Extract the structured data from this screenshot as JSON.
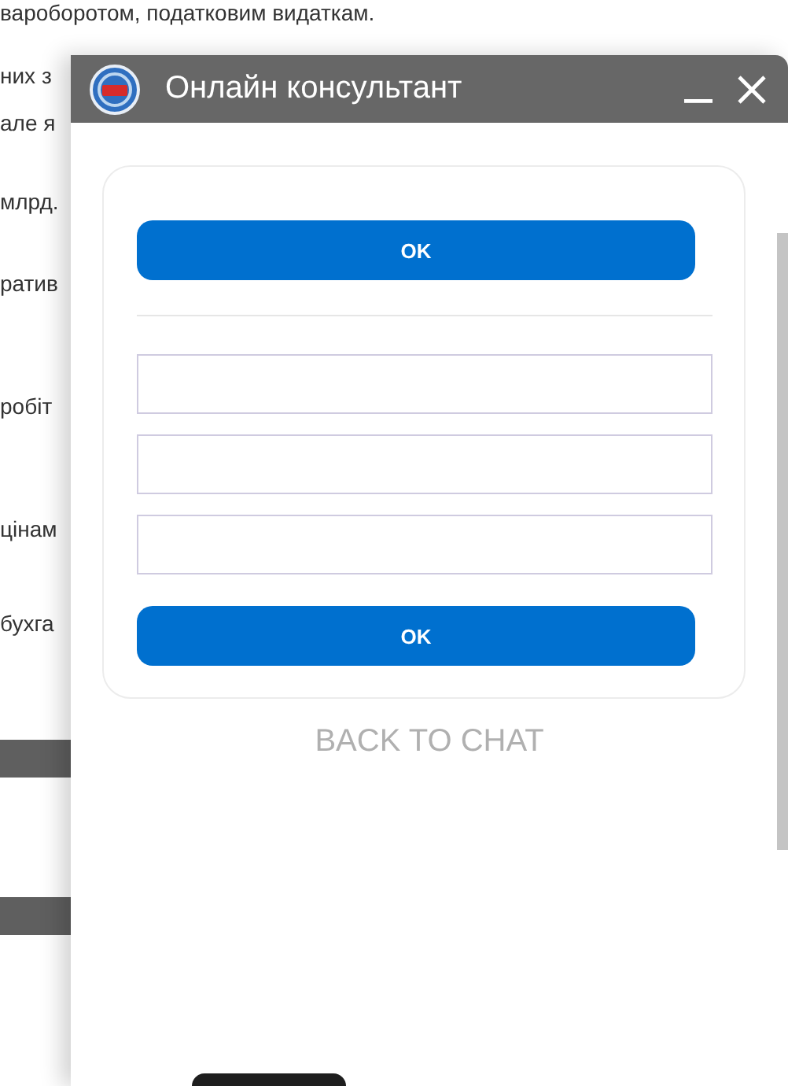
{
  "background_page": {
    "top_line": "вароборотом, податковим видаткам.",
    "fragments": [
      "них з",
      "але я",
      "млрд.",
      "ратив",
      "робіт",
      "цінам",
      "бухга"
    ]
  },
  "chat_window": {
    "title": "Онлайн консультант",
    "form": {
      "top_button": "OK",
      "fields": [
        {
          "kind": "text"
        },
        {
          "kind": "text"
        },
        {
          "kind": "text"
        }
      ],
      "submit_button": "OK"
    },
    "back_link": "BACK TO CHAT"
  }
}
